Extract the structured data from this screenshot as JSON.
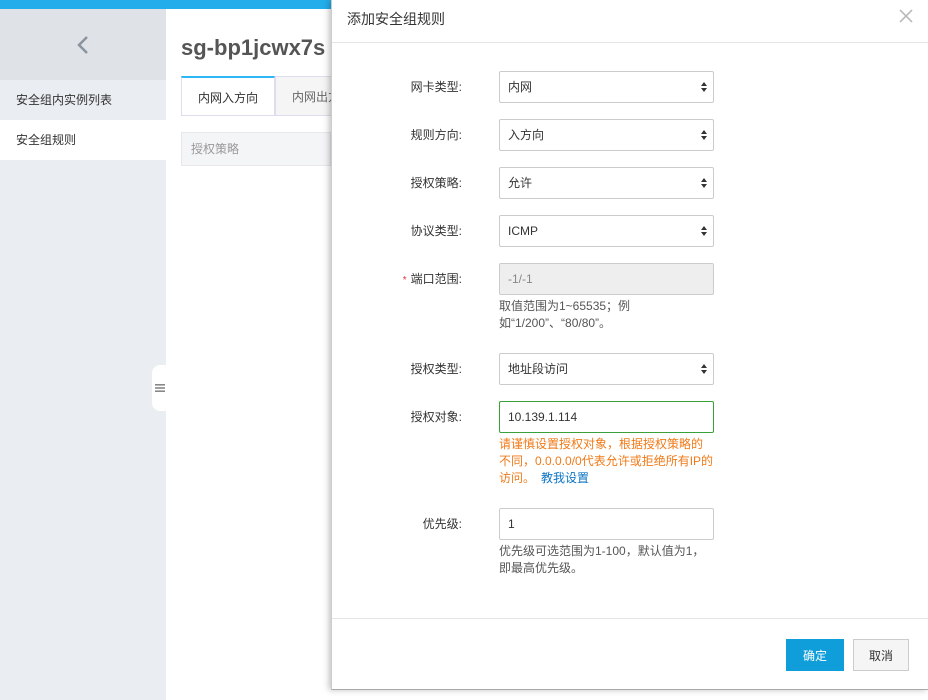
{
  "sidebar": {
    "items": [
      {
        "label": "安全组内实例列表"
      },
      {
        "label": "安全组规则"
      }
    ]
  },
  "main": {
    "title": "sg-bp1jcwx7s",
    "tabs": [
      {
        "label": "内网入方向"
      },
      {
        "label": "内网出方"
      }
    ],
    "filter_label": "授权策略"
  },
  "dialog": {
    "title": "添加安全组规则",
    "fields": {
      "nic_type": {
        "label": "网卡类型:",
        "value": "内网"
      },
      "direction": {
        "label": "规则方向:",
        "value": "入方向"
      },
      "policy": {
        "label": "授权策略:",
        "value": "允许"
      },
      "protocol": {
        "label": "协议类型:",
        "value": "ICMP"
      },
      "port_range": {
        "required_mark": "*",
        "label": "端口范围:",
        "value": "-1/-1",
        "hint_line1": "取值范围为1~65535；例",
        "hint_line2": "如“1/200”、“80/80”。"
      },
      "auth_type": {
        "label": "授权类型:",
        "value": "地址段访问"
      },
      "auth_object": {
        "label": "授权对象:",
        "value": "10.139.1.114",
        "warn_line1": "请谨慎设置授权对象，根据授权策略的",
        "warn_line2": "不同，0.0.0.0/0代表允许或拒绝所有IP的",
        "warn_line3": "访问。",
        "link": "教我设置"
      },
      "priority": {
        "label": "优先级:",
        "value": "1",
        "hint_line1": "优先级可选范围为1-100，默认值为1，",
        "hint_line2": "即最高优先级。"
      }
    },
    "ok_label": "确定",
    "cancel_label": "取消"
  },
  "colors": {
    "primary": "#0f9ed9",
    "warning": "#f07a18",
    "link": "#0c73c2",
    "focus_border": "#3aa03a"
  }
}
